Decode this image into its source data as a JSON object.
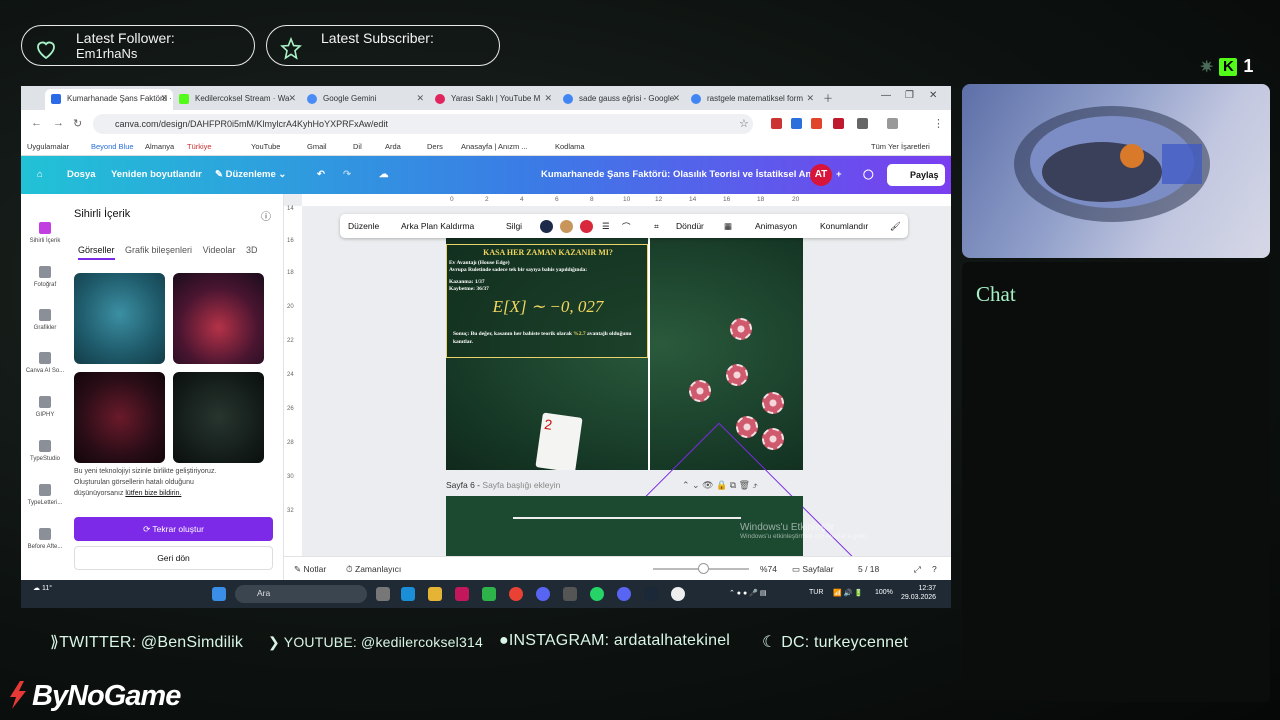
{
  "overlay": {
    "follower_label": "Latest Follower:",
    "follower_name": "Em1rhaNs",
    "subscriber_label": "Latest Subscriber:",
    "kick_count": "1",
    "chat_title": "Chat",
    "socials": {
      "twitter": "TWITTER: @BenSimdilik",
      "youtube": "YOUTUBE: @kedilercoksel314",
      "instagram": "INSTAGRAM: ardatalhatekinel",
      "discord": "DC: turkeycennet"
    },
    "brand": "ByNoGame"
  },
  "browser": {
    "tabs": [
      {
        "title": "Kumarhanade Şans Faktörü · Wa",
        "color": "#2b6ce6"
      },
      {
        "title": "Kedilercoksel Stream · Wa",
        "color": "#53fc18"
      },
      {
        "title": "Google Gemini",
        "color": "#4b8bf5"
      },
      {
        "title": "Yarası Saklı | YouTube M",
        "color": "#e0245e"
      },
      {
        "title": "sade gauss eğrisi - Google",
        "color": "#4285f4"
      },
      {
        "title": "rastgele matematiksel form",
        "color": "#4285f4"
      }
    ],
    "url": "canva.com/design/DAHFPR0i5mM/KlmylcrA4KyhHoYXPRFxAw/edit",
    "bookmarks": [
      "Uygulamalar",
      "Beyond Blue",
      "Almanya",
      "Türkiye",
      "YouTube",
      "Gmail",
      "Dil",
      "Arda",
      "Ders",
      "Anasayfa | Anızm ...",
      "Kodlama",
      "Tüm Yer İşaretleri"
    ]
  },
  "canva": {
    "menu": {
      "file": "Dosya",
      "resize": "Yeniden boyutlandır",
      "edit": "Düzenleme",
      "title": "Kumarhanede Şans Faktörü: Olasılık Teorisi ve İstatiksel Ana...",
      "avatar": "AT",
      "share": "Paylaş"
    },
    "rail": [
      "Sihirli İçerik",
      "Fotoğraf",
      "Grafikler",
      "Canva AI So...",
      "GIPHY",
      "TypeStudio",
      "TypeLetteri...",
      "Before Afte..."
    ],
    "panel": {
      "title": "Sihirli İçerik",
      "subtabs": [
        "Görseller",
        "Grafik bileşenleri",
        "Videolar",
        "3D"
      ],
      "note": "Bu yeni teknolojiyi sizinle birlikte geliştiriyoruz. Oluşturulan görsellerin hatalı olduğunu düşünüyorsanız",
      "note_link": "lütfen bize bildirin.",
      "regen": "Tekrar oluştur",
      "back": "Geri dön"
    },
    "toolbar": {
      "edit": "Düzenle",
      "bg_remove": "Arka Plan Kaldırma",
      "delete": "Silgi",
      "rotate": "Döndür",
      "animate": "Animasyon",
      "position": "Konumlandır",
      "colors": [
        "#1e2a4a",
        "#c8955a",
        "#d8283c"
      ]
    },
    "ruler_top": [
      "0",
      "2",
      "4",
      "6",
      "8",
      "10",
      "12",
      "14",
      "16",
      "18",
      "20"
    ],
    "ruler_left": [
      "14",
      "16",
      "18",
      "20",
      "22",
      "24",
      "26",
      "28",
      "30",
      "32"
    ],
    "slide": {
      "heading": "KASA HER ZAMAN KAZANIR MI?",
      "line1": "Ev Avantajı (House Edge)",
      "line2": "Avrupa Ruletinde sadece tek bir sayıya bahis yapıldığında:",
      "line3": "Kazanma: 1/37",
      "line4": "Kaybetme: 36/37",
      "equation": "E[X] ∼ −0, 027",
      "note_a": "Sonuç: Bu değer, kasanın her bahiste teorik olarak",
      "note_pct": "%2.7",
      "note_b": "avantajlı olduğunu kanıtlar.",
      "card_rank": "2"
    },
    "page_caption_num": "Sayfa 6 -",
    "page_caption_add": "Sayfa başlığı ekleyin",
    "watermark": "Windows'u Etkinleştir",
    "watermark_sub": "Windows'u etkinleştirmek için Ayarlar'a gidin.",
    "footer": {
      "notes": "Notlar",
      "timer": "Zamanlayıcı",
      "zoom": "%74",
      "pages_label": "Sayfalar",
      "page_count": "5 / 18"
    }
  },
  "taskbar": {
    "weather": "11°",
    "search": "Ara",
    "lang": "TUR",
    "battery": "100%",
    "time": "12:37",
    "date": "29.03.2026"
  }
}
